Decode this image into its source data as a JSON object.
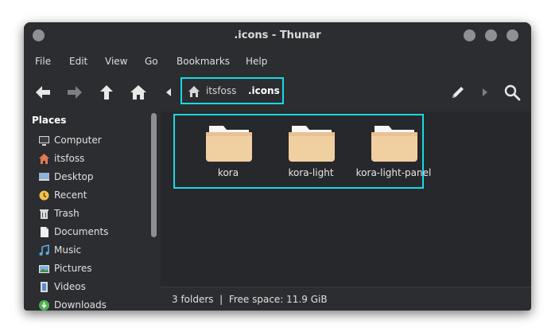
{
  "window": {
    "title": ".icons - Thunar"
  },
  "menu": [
    "File",
    "Edit",
    "View",
    "Go",
    "Bookmarks",
    "Help"
  ],
  "toolbar": {
    "back_icon": "arrow-left-icon",
    "forward_icon": "arrow-right-icon",
    "up_icon": "arrow-up-icon",
    "home_icon": "home-icon",
    "path_toggle_icon": "triangle-left-icon",
    "edit_icon": "pencil-icon",
    "next_icon": "triangle-right-icon",
    "search_icon": "search-icon"
  },
  "breadcrumb": {
    "items": [
      "itsfoss",
      ".icons"
    ]
  },
  "sidebar": {
    "title": "Places",
    "items": [
      {
        "label": "Computer",
        "icon": "monitor-icon"
      },
      {
        "label": "itsfoss",
        "icon": "home-icon"
      },
      {
        "label": "Desktop",
        "icon": "desktop-icon"
      },
      {
        "label": "Recent",
        "icon": "clock-icon"
      },
      {
        "label": "Trash",
        "icon": "trash-icon"
      },
      {
        "label": "Documents",
        "icon": "document-icon"
      },
      {
        "label": "Music",
        "icon": "music-icon"
      },
      {
        "label": "Pictures",
        "icon": "pictures-icon"
      },
      {
        "label": "Videos",
        "icon": "video-icon"
      },
      {
        "label": "Downloads",
        "icon": "download-icon"
      }
    ]
  },
  "folders": [
    "kora",
    "kora-light",
    "kora-light-panel"
  ],
  "status": {
    "text": "3 folders  |  Free space: 11.9 GiB"
  },
  "colors": {
    "highlight": "#17d9e6",
    "folder": "#f0cfa0"
  }
}
